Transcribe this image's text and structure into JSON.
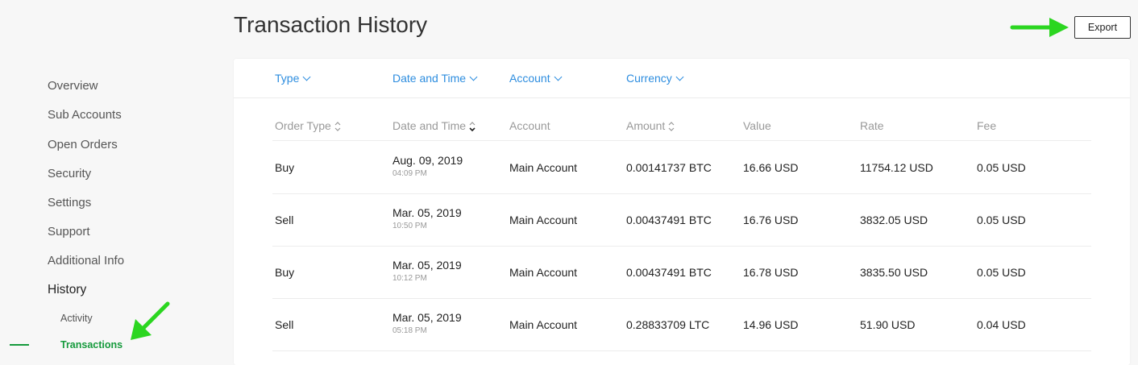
{
  "sidebar": {
    "items": [
      {
        "label": "Overview"
      },
      {
        "label": "Sub Accounts"
      },
      {
        "label": "Open Orders"
      },
      {
        "label": "Security"
      },
      {
        "label": "Settings"
      },
      {
        "label": "Support"
      },
      {
        "label": "Additional Info"
      },
      {
        "label": "History"
      }
    ],
    "sub_items": [
      {
        "label": "Activity"
      },
      {
        "label": "Transactions"
      }
    ]
  },
  "header": {
    "title": "Transaction History",
    "export_label": "Export"
  },
  "filters": [
    "Type",
    "Date and Time",
    "Account",
    "Currency"
  ],
  "columns": [
    "Order Type",
    "Date and Time",
    "Account",
    "Amount",
    "Value",
    "Rate",
    "Fee"
  ],
  "rows": [
    {
      "type": "Buy",
      "date": "Aug. 09, 2019",
      "time": "04:09 PM",
      "account": "Main Account",
      "amount": "0.00141737 BTC",
      "value": "16.66 USD",
      "rate": "11754.12 USD",
      "fee": "0.05 USD"
    },
    {
      "type": "Sell",
      "date": "Mar. 05, 2019",
      "time": "10:50 PM",
      "account": "Main Account",
      "amount": "0.00437491 BTC",
      "value": "16.76 USD",
      "rate": "3832.05 USD",
      "fee": "0.05 USD"
    },
    {
      "type": "Buy",
      "date": "Mar. 05, 2019",
      "time": "10:12 PM",
      "account": "Main Account",
      "amount": "0.00437491 BTC",
      "value": "16.78 USD",
      "rate": "3835.50 USD",
      "fee": "0.05 USD"
    },
    {
      "type": "Sell",
      "date": "Mar. 05, 2019",
      "time": "05:18 PM",
      "account": "Main Account",
      "amount": "0.28833709 LTC",
      "value": "14.96 USD",
      "rate": "51.90 USD",
      "fee": "0.04 USD"
    }
  ],
  "colors": {
    "accent_green": "#159a3c",
    "link_blue": "#2d8ddf",
    "arrow_green": "#2bd620"
  }
}
